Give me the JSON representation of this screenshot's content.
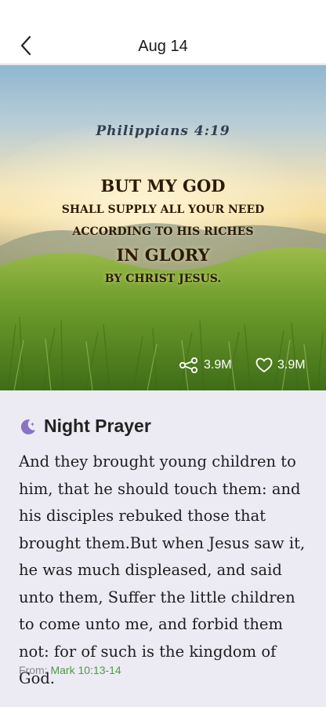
{
  "header": {
    "title": "Aug 14"
  },
  "hero": {
    "reference": "Philippians 4:19",
    "verse_lines": [
      "BUT MY GOD",
      "SHALL SUPPLY ALL YOUR NEED",
      "ACCORDING TO HIS RICHES",
      "IN GLORY",
      "BY CHRIST JESUS."
    ],
    "share_count": "3.9M",
    "like_count": "3.9M"
  },
  "prayer": {
    "title": "Night Prayer",
    "icon": "moon-star-icon",
    "text": "And they brought young children to him, that he should touch them: and his disciples rebuked those that brought them.But when Jesus saw it, he was much displeased, and said unto them, Suffer the little children to come unto me, and forbid them not: for of such is the kingdom of God.",
    "from_label": "From:",
    "from_ref": "Mark 10:13-14"
  },
  "colors": {
    "accent_green": "#4e9a45",
    "moon_purple": "#8a72c4",
    "content_bg": "#ecebf4"
  }
}
